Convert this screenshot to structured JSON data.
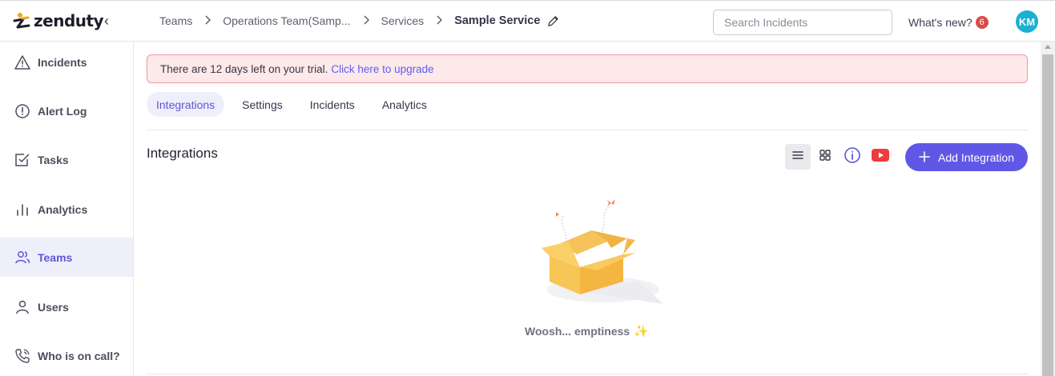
{
  "app": {
    "brand": "zenduty",
    "collapse_glyph": "‹"
  },
  "breadcrumb": {
    "items": [
      "Teams",
      "Operations Team(Samp...",
      "Services"
    ],
    "current": "Sample Service",
    "separator": "›"
  },
  "header": {
    "search_placeholder": "Search Incidents",
    "whats_new_label": "What's new?",
    "whats_new_count": "6",
    "avatar_initials": "KM"
  },
  "sidebar": {
    "items": [
      {
        "label": "Incidents",
        "icon": "warning-triangle-icon"
      },
      {
        "label": "Alert Log",
        "icon": "alert-circle-icon"
      },
      {
        "label": "Tasks",
        "icon": "checkbox-icon"
      },
      {
        "label": "Analytics",
        "icon": "bar-chart-icon"
      },
      {
        "label": "Teams",
        "icon": "users-icon",
        "active": true
      },
      {
        "label": "Users",
        "icon": "user-icon"
      },
      {
        "label": "Who is on call?",
        "icon": "phone-icon"
      }
    ]
  },
  "banner": {
    "text": "There are 12 days left on your trial.",
    "link": "Click here to upgrade"
  },
  "tabs": [
    {
      "label": "Integrations",
      "active": true
    },
    {
      "label": "Settings"
    },
    {
      "label": "Incidents"
    },
    {
      "label": "Analytics"
    }
  ],
  "integrations": {
    "title": "Integrations",
    "add_button": "Add Integration",
    "view_mode": "list",
    "empty_text": "Woosh... emptiness",
    "empty_emoji": "✨"
  },
  "colors": {
    "accent": "#6157e6",
    "active_bg": "#efeffb",
    "banner_bg": "#fde9ea",
    "banner_border": "#ec9aa0",
    "avatar": "#1db0d0",
    "badge": "#d94a4a",
    "youtube": "#ef3b3b"
  }
}
